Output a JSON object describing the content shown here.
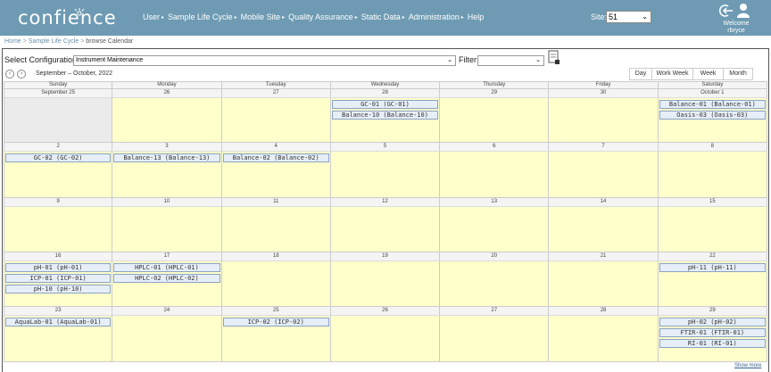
{
  "header": {
    "logo": "confience",
    "nav": [
      "User",
      "Sample Life Cycle",
      "Mobile Site",
      "Quality Assurance",
      "Static Data",
      "Administration",
      "Help"
    ],
    "site_label": "Site:",
    "site_value": "51",
    "welcome": "Welcome",
    "username": "rbryce"
  },
  "breadcrumb": [
    "Home",
    "Sample Life Cycle",
    "browse Calendar"
  ],
  "config": {
    "label": "Select Configuration:",
    "value": "Instrument Maintenance",
    "filter_label": "Filter:",
    "filter_value": ""
  },
  "toolbar": {
    "range": "September – October, 2022",
    "views": [
      "Day",
      "Work Week",
      "Week",
      "Month"
    ],
    "active_view": "Month"
  },
  "calendar": {
    "days_of_week": [
      "Sunday",
      "Monday",
      "Tuesday",
      "Wednesday",
      "Thursday",
      "Friday",
      "Saturday"
    ],
    "weeks": [
      {
        "days": [
          {
            "label": "September 25",
            "other": true,
            "events": []
          },
          {
            "label": "26",
            "events": []
          },
          {
            "label": "27",
            "events": []
          },
          {
            "label": "28",
            "events": [
              "GC-01 (GC-01)",
              "Balance-10 (Balance-10)"
            ]
          },
          {
            "label": "29",
            "events": []
          },
          {
            "label": "30",
            "events": []
          },
          {
            "label": "October 1",
            "events": [
              "Balance-01 (Balance-01)",
              "Oasis-03 (Oasis-03)"
            ]
          }
        ]
      },
      {
        "days": [
          {
            "label": "2",
            "events": [
              "GC-02 (GC-02)"
            ]
          },
          {
            "label": "3",
            "events": [
              "Balance-13 (Balance-13)"
            ]
          },
          {
            "label": "4",
            "events": [
              "Balance-02 (Balance-02)"
            ]
          },
          {
            "label": "5",
            "events": []
          },
          {
            "label": "6",
            "events": []
          },
          {
            "label": "7",
            "events": []
          },
          {
            "label": "8",
            "events": []
          }
        ]
      },
      {
        "days": [
          {
            "label": "9",
            "events": []
          },
          {
            "label": "10",
            "events": []
          },
          {
            "label": "11",
            "events": []
          },
          {
            "label": "12",
            "events": []
          },
          {
            "label": "13",
            "events": []
          },
          {
            "label": "14",
            "events": []
          },
          {
            "label": "15",
            "events": []
          }
        ]
      },
      {
        "days": [
          {
            "label": "16",
            "events": [
              "pH-01 (pH-01)",
              "ICP-01 (ICP-01)",
              "pH-10 (pH-10)"
            ]
          },
          {
            "label": "17",
            "events": [
              "HPLC-01 (HPLC-01)",
              "HPLC-02 (HPLC-02)"
            ]
          },
          {
            "label": "18",
            "events": []
          },
          {
            "label": "19",
            "events": []
          },
          {
            "label": "20",
            "events": []
          },
          {
            "label": "21",
            "events": []
          },
          {
            "label": "22",
            "events": [
              "pH-11 (pH-11)"
            ]
          }
        ]
      },
      {
        "days": [
          {
            "label": "23",
            "events": [
              "AquaLab-01 (AquaLab-01)"
            ]
          },
          {
            "label": "24",
            "events": []
          },
          {
            "label": "25",
            "events": [
              "ICP-02 (ICP-02)"
            ]
          },
          {
            "label": "26",
            "events": []
          },
          {
            "label": "27",
            "events": []
          },
          {
            "label": "28",
            "events": []
          },
          {
            "label": "29",
            "events": [
              "pH-02 (pH-02)",
              "FTIR-01 (FTIR-01)",
              "RI-01 (RI-01)"
            ]
          }
        ]
      }
    ],
    "show_more": "Show more"
  },
  "colors": {
    "header": "#6e9bb3",
    "cell": "#ffffcc",
    "event_bg": "#e6eef8",
    "event_border": "#8aa3c4"
  }
}
